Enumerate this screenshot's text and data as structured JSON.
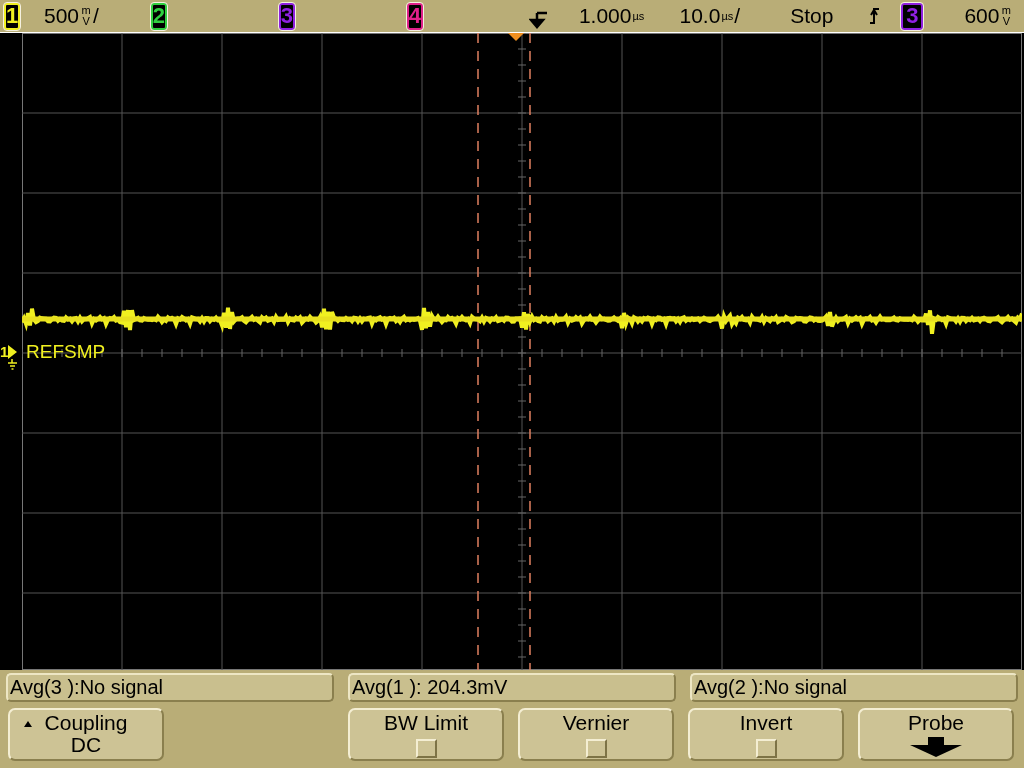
{
  "top_bar": {
    "channels": [
      {
        "label": "1",
        "color": "#f0f020",
        "scale": {
          "value": "500",
          "unit": "mV",
          "per": "/"
        }
      },
      {
        "label": "2",
        "color": "#30d040"
      },
      {
        "label": "3",
        "color": "#9020e0"
      },
      {
        "label": "4",
        "color": "#e0208a"
      }
    ],
    "delay": {
      "value": "1.000",
      "unit": "µs"
    },
    "timebase": {
      "value": "10.0",
      "unit": "µs",
      "per": "/"
    },
    "status": "Stop",
    "trigger_source": {
      "label": "3",
      "color": "#9020e0"
    },
    "trigger_level": {
      "value": "600",
      "unit": "mV"
    }
  },
  "screen": {
    "trace_label": {
      "channel": "1",
      "name": "REFSMP",
      "color": "#f0f020"
    }
  },
  "readouts": [
    "Avg(3 ):No signal",
    "Avg(1 ): 204.3mV",
    "Avg(2 ):No signal"
  ],
  "softkeys": [
    {
      "kind": "menu",
      "label": "Coupling",
      "value": "DC"
    },
    {
      "kind": "empty"
    },
    {
      "kind": "checkbox",
      "label": "BW Limit",
      "checked": false
    },
    {
      "kind": "checkbox",
      "label": "Vernier",
      "checked": false
    },
    {
      "kind": "checkbox",
      "label": "Invert",
      "checked": false
    },
    {
      "kind": "submenu",
      "label": "Probe"
    }
  ]
}
